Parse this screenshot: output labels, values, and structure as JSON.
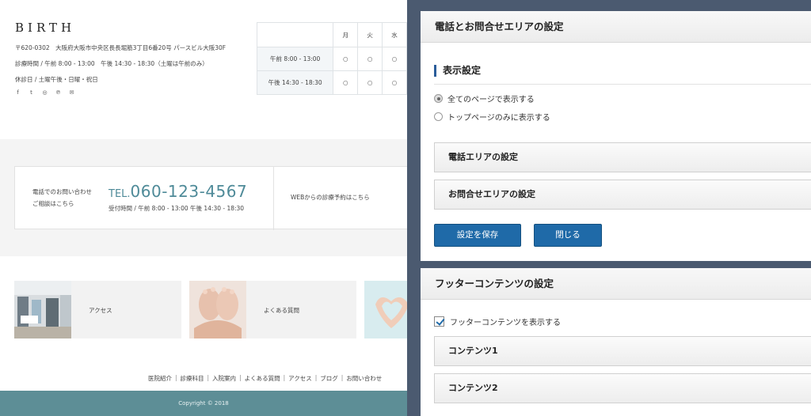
{
  "site": {
    "brand": "BIRTH",
    "address": "〒620-0302　大阪府大阪市中央区長長堀筋3丁目6番20号 パースビル大阪30F",
    "hours": "診療時間 / 午前 8:00 - 13:00　午後 14:30 - 18:30（土曜は午前のみ）",
    "closed": "休診日 / 土曜午後・日曜・祝日",
    "social_icons": [
      "facebook-icon",
      "twitter-icon",
      "instagram-icon",
      "pinterest-icon",
      "mail-icon"
    ],
    "social_glyphs": [
      "f",
      "t",
      "◎",
      "℗",
      "✉"
    ],
    "schedule": {
      "days": [
        "月",
        "火",
        "水"
      ],
      "rows": [
        {
          "label": "午前 8:00 - 13:00",
          "marks": [
            "○",
            "○",
            "○"
          ]
        },
        {
          "label": "午後 14:30 - 18:30",
          "marks": [
            "○",
            "○",
            "○"
          ]
        }
      ]
    },
    "contact": {
      "phone_label": "電話でのお問い合わせ",
      "phone_sub": "ご相談はこちら",
      "tel_prefix": "TEL.",
      "tel_number": "060-123-4567",
      "tel_hours": "受付時間 / 午前 8:00 - 13:00 午後 14:30 - 18:30",
      "web_label": "WEBからの診療予約はこちら"
    },
    "cards": [
      {
        "label": "アクセス"
      },
      {
        "label": "よくある質問"
      },
      {
        "label": ""
      }
    ],
    "footer_nav": [
      "医院紹介",
      "診療科目",
      "入院案内",
      "よくある質問",
      "アクセス",
      "ブログ",
      "お問い合わせ"
    ],
    "footer_sep": "|",
    "copyright": "Copyright © 2018"
  },
  "panel": {
    "contact_settings": {
      "title": "電話とお問合せエリアの設定",
      "display_section": "表示設定",
      "radio_all": "全てのページで表示する",
      "radio_top": "トップページのみに表示する",
      "acc_phone": "電話エリアの設定",
      "acc_contact": "お問合せエリアの設定",
      "save_label": "設定を保存",
      "close_label": "閉じる"
    },
    "footer_settings": {
      "title": "フッターコンテンツの設定",
      "show_label": "フッターコンテンツを表示する",
      "content1": "コンテンツ1",
      "content2": "コンテンツ2"
    }
  },
  "colors": {
    "teal": "#5d8e96",
    "tel": "#4e8a98",
    "button": "#1f6aa8",
    "panel_bg": "#4b5a70",
    "section_accent": "#2b5d9a"
  }
}
